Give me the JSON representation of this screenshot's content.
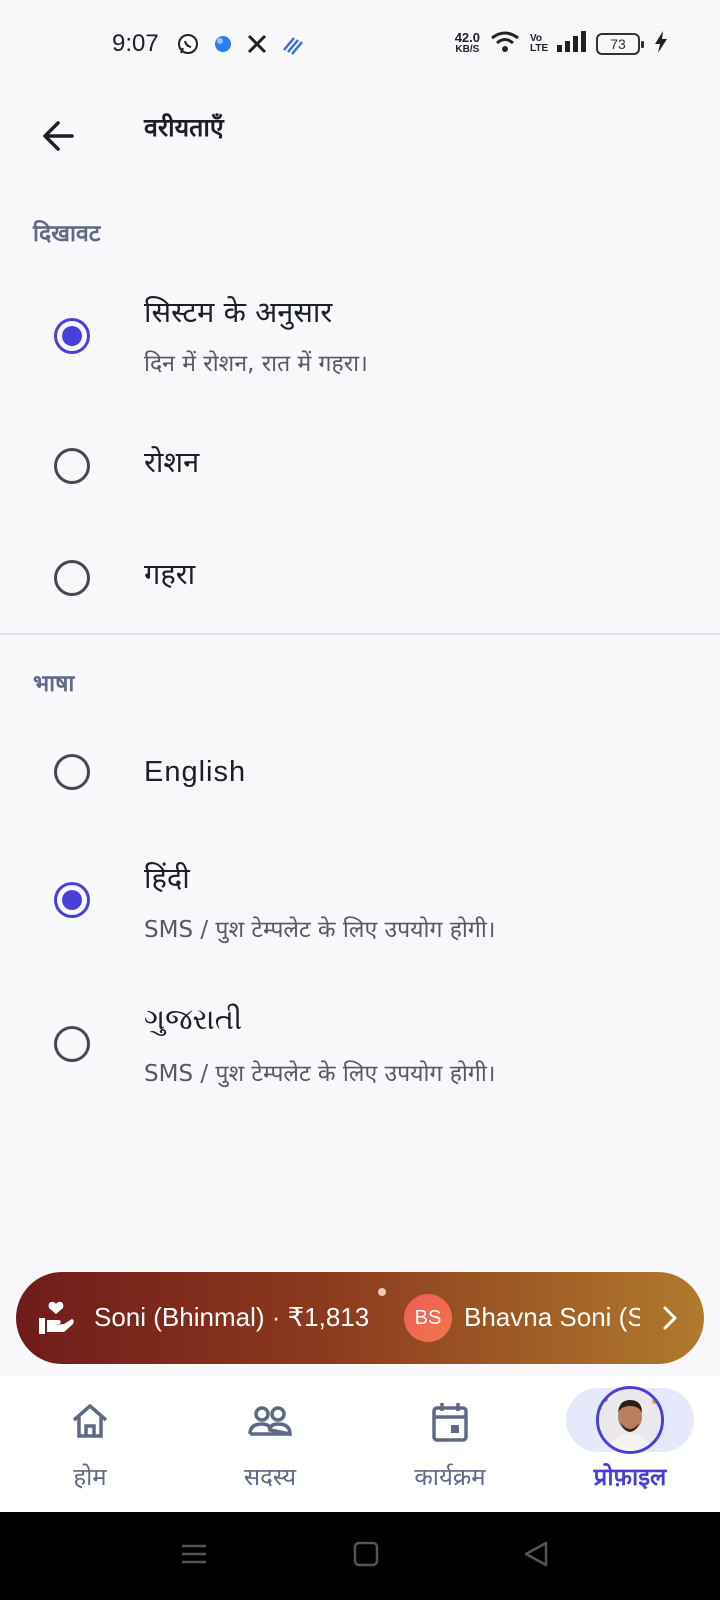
{
  "status_bar": {
    "time": "9:07",
    "net_speed_value": "42.0",
    "net_speed_unit": "KB/S",
    "volte": "Vo LTE",
    "battery": "73"
  },
  "app_bar": {
    "title": "वरीयताएँ"
  },
  "appearance": {
    "header": "दिखावट",
    "options": [
      {
        "label": "सिस्टम के अनुसार",
        "sublabel": "दिन में रोशन, रात में गहरा।",
        "selected": true
      },
      {
        "label": "रोशन",
        "selected": false
      },
      {
        "label": "गहरा",
        "selected": false
      }
    ]
  },
  "language": {
    "header": "भाषा",
    "options": [
      {
        "label": "English",
        "selected": false
      },
      {
        "label": "हिंदी",
        "sublabel": "SMS / पुश टेम्पलेट के लिए उपयोग होगी।",
        "selected": true
      },
      {
        "label": "ગુજરાતી",
        "sublabel": "SMS / पुश टेम्पलेट के लिए उपयोग होगी।",
        "selected": false
      }
    ]
  },
  "banner": {
    "donation_text": "Soni (Bhinmal) · ₹1,813",
    "avatar_initials": "BS",
    "member_text": "Bhavna Soni (S"
  },
  "bottom_nav": {
    "items": [
      {
        "label": "होम",
        "icon": "home-icon"
      },
      {
        "label": "सदस्य",
        "icon": "members-icon"
      },
      {
        "label": "कार्यक्रम",
        "icon": "calendar-icon"
      },
      {
        "label": "प्रोफ़ाइल",
        "icon": "avatar",
        "active": true
      }
    ]
  },
  "colors": {
    "accent": "#4b3fd9",
    "section_header": "#5e6a85",
    "background": "#f8f8fa"
  }
}
